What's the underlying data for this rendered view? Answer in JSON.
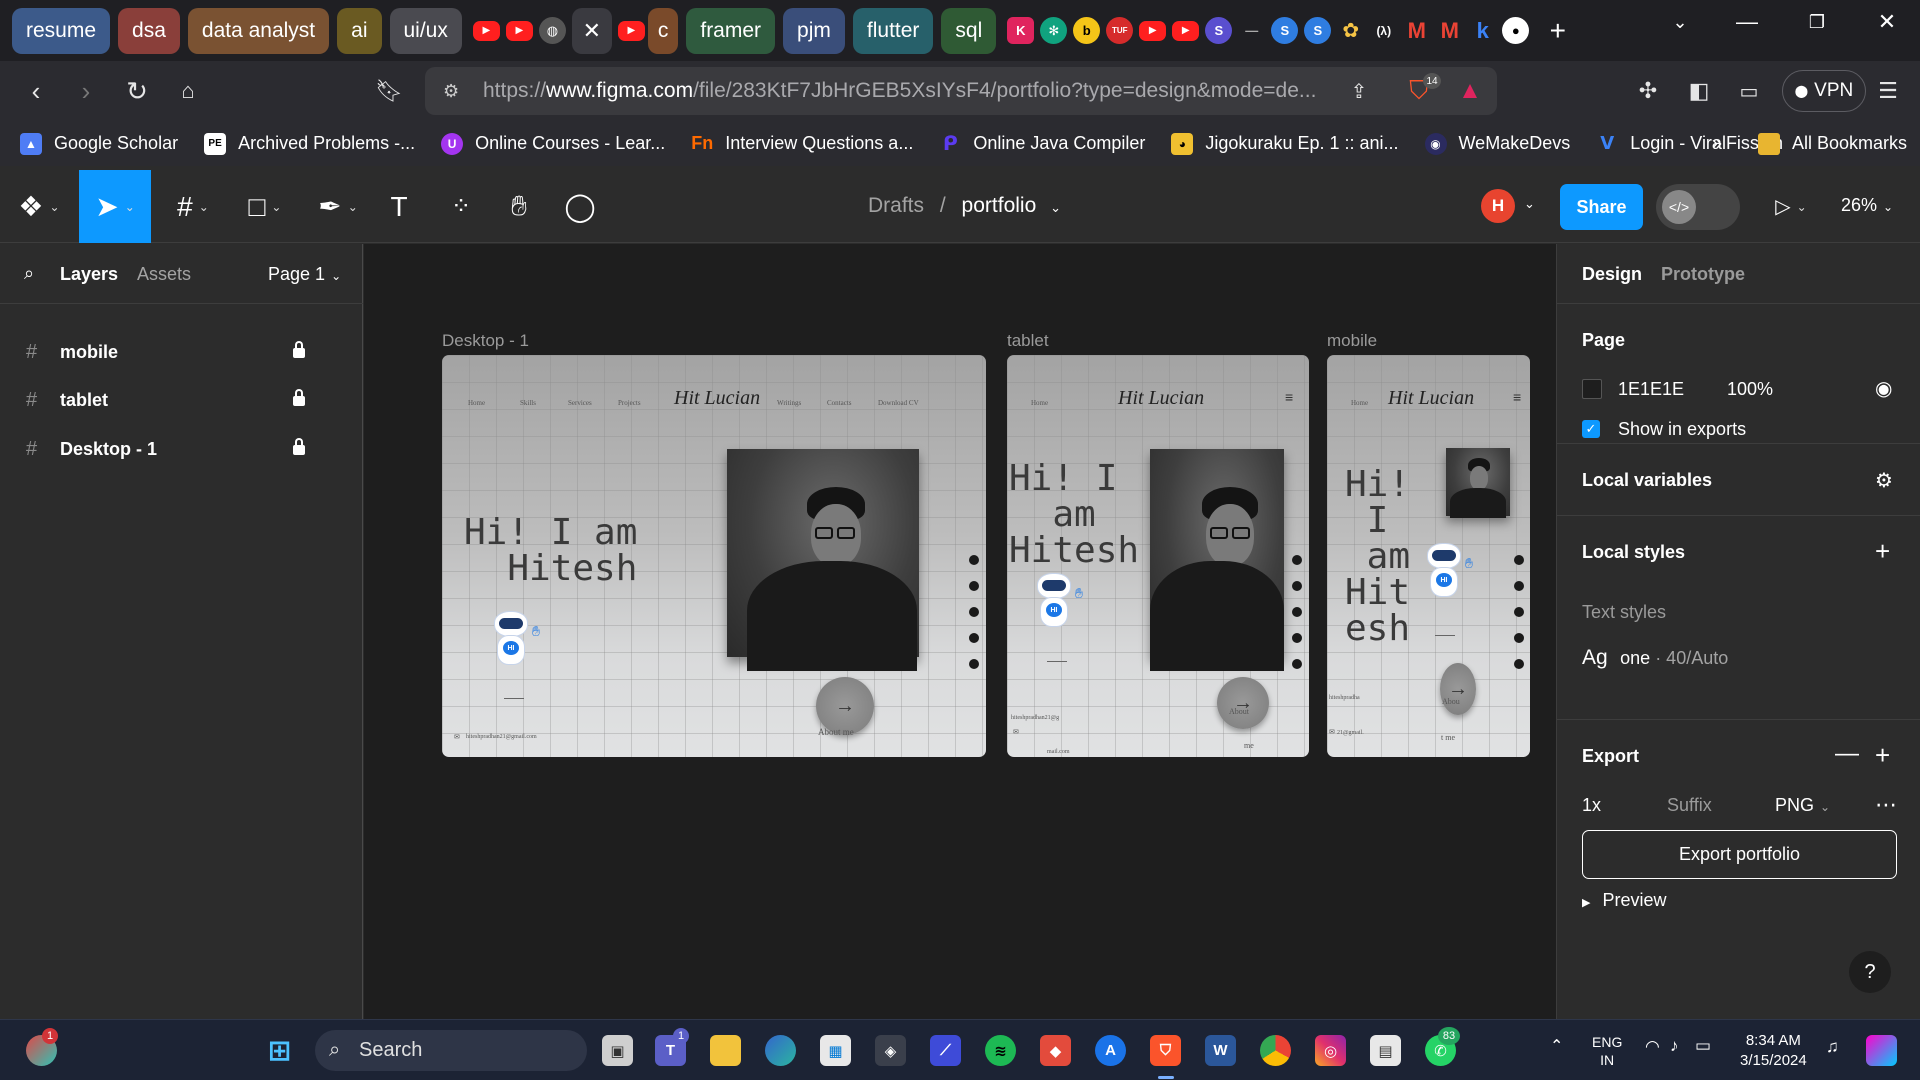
{
  "browser": {
    "tab_groups": [
      {
        "label": "resume",
        "color": "#3c5a8a"
      },
      {
        "label": "dsa",
        "color": "#8a3f3a"
      },
      {
        "label": "data analyst",
        "color": "#7a5232"
      },
      {
        "label": "ai",
        "color": "#6a5a22"
      },
      {
        "label": "ui/ux",
        "color": "#4a4a50"
      }
    ],
    "tab_groups_right": [
      {
        "label": "c",
        "color": "#7a4a2a"
      },
      {
        "label": "framer",
        "color": "#2f5a3e"
      },
      {
        "label": "pjm",
        "color": "#3a4e7a"
      },
      {
        "label": "flutter",
        "color": "#27606a"
      },
      {
        "label": "sql",
        "color": "#2f5a34"
      }
    ],
    "url_prefix": "https://",
    "url_domain": "www.figma.com",
    "url_path": "/file/283KtF7JbHrGEB5XsIYsF4/portfolio?type=design&mode=de...",
    "shield_count": "14",
    "vpn_label": "VPN",
    "bookmarks": [
      {
        "label": "Google Scholar",
        "icon": "graduation-cap-icon",
        "color": "#4f7df5"
      },
      {
        "label": "Archived Problems -...",
        "icon": "pe-icon",
        "color": "#ffffff"
      },
      {
        "label": "Online Courses - Lear...",
        "icon": "udemy-icon",
        "color": "#a435f0"
      },
      {
        "label": "Interview Questions a...",
        "icon": "fn-icon",
        "color": "#ff6a00"
      },
      {
        "label": "Online Java Compiler",
        "icon": "programiz-icon",
        "color": "#5b3bf0"
      },
      {
        "label": "Jigokuraku Ep. 1 :: ani...",
        "icon": "anime-icon",
        "color": "#f0c030"
      },
      {
        "label": "WeMakeDevs",
        "icon": "wemakedevs-icon",
        "color": "#6a5acd"
      },
      {
        "label": "Login - ViralFission",
        "icon": "viralfission-icon",
        "color": "#3b82f6"
      }
    ],
    "bookmarks_more": "»",
    "all_bookmarks": "All Bookmarks"
  },
  "figma": {
    "breadcrumb_root": "Drafts",
    "breadcrumb_sep": "/",
    "file_name": "portfolio",
    "avatar_letter": "H",
    "share_label": "Share",
    "zoom": "26%",
    "left_tabs": {
      "layers": "Layers",
      "assets": "Assets",
      "page": "Page 1"
    },
    "layers": [
      {
        "name": "mobile"
      },
      {
        "name": "tablet"
      },
      {
        "name": "Desktop - 1"
      }
    ],
    "frames": {
      "desktop": {
        "label": "Desktop - 1",
        "nav_left": [
          "Home",
          "Skills",
          "Services",
          "Projects"
        ],
        "logo": "Hit Lucian",
        "nav_right": [
          "Writings",
          "Contacts",
          "Download CV"
        ],
        "hero": "Hi! I am\n  Hitesh",
        "email": "hiteshpradhan21@gmail.com",
        "about": "About me"
      },
      "tablet": {
        "label": "tablet",
        "nav_left": "Home",
        "logo": "Hit Lucian",
        "hero": "Hi! I\n  am\nHitesh",
        "email": "hiteshpradhan21@g",
        "email2": "mail.com",
        "about": "About",
        "about2": "me"
      },
      "mobile": {
        "label": "mobile",
        "nav_left": "Home",
        "logo": "Hit Lucian",
        "hero": "Hi!\n I\n am\nHit\nesh",
        "email": "hiteshpradha",
        "email2": "21@gmail.",
        "about": "Abou",
        "about2": "t me"
      }
    },
    "right_tabs": {
      "design": "Design",
      "prototype": "Prototype"
    },
    "page_section": {
      "title": "Page",
      "color_hex": "1E1E1E",
      "color": "#1e1e1e",
      "opacity": "100%",
      "show_exports": "Show in exports"
    },
    "local_variables": "Local variables",
    "local_styles": "Local styles",
    "text_styles_heading": "Text styles",
    "text_style": {
      "sample": "Ag",
      "name": "one",
      "spec": " · 40/Auto"
    },
    "export": {
      "title": "Export",
      "scale": "1x",
      "suffix_placeholder": "Suffix",
      "format": "PNG",
      "button": "Export portfolio",
      "preview": "Preview"
    },
    "help": "?"
  },
  "taskbar": {
    "search_placeholder": "Search",
    "lang_top": "ENG",
    "lang_bottom": "IN",
    "time": "8:34 AM",
    "date": "3/15/2024",
    "teams_badge": "1",
    "whatsapp_badge": "83",
    "widget_badge": "1"
  }
}
